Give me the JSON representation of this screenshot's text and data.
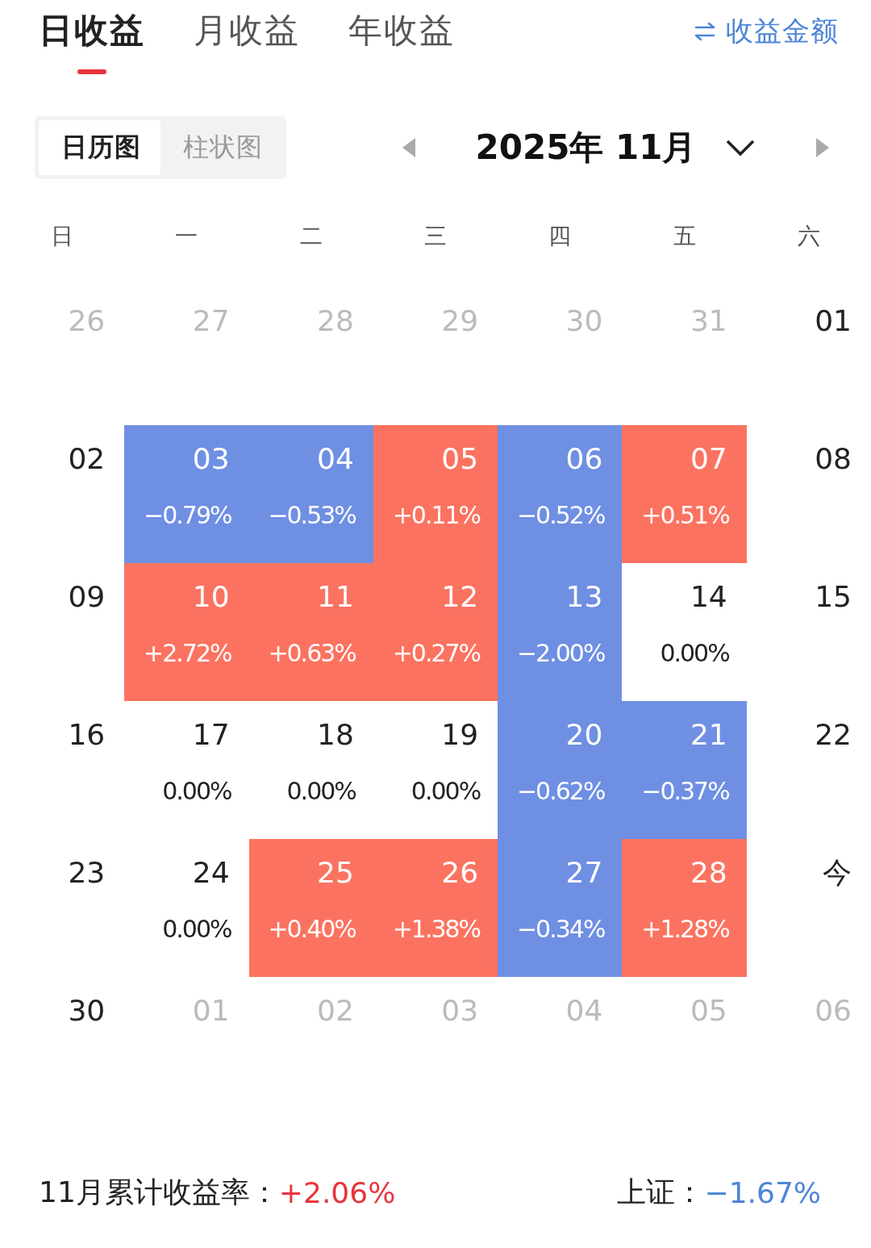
{
  "tabs": [
    {
      "label": "日收益",
      "selected": true
    },
    {
      "label": "月收益",
      "selected": false
    },
    {
      "label": "年收益",
      "selected": false
    }
  ],
  "switch_link": {
    "label": "收益金额"
  },
  "view_toggle": [
    {
      "label": "日历图",
      "selected": true
    },
    {
      "label": "柱状图",
      "selected": false
    }
  ],
  "month_picker": {
    "label": "2025年 11月"
  },
  "weekdays": [
    "日",
    "一",
    "二",
    "三",
    "四",
    "五",
    "六"
  ],
  "weeks": [
    {
      "days": [
        {
          "day": "26",
          "muted": true
        },
        {
          "day": "27",
          "muted": true
        },
        {
          "day": "28",
          "muted": true
        },
        {
          "day": "29",
          "muted": true
        },
        {
          "day": "30",
          "muted": true
        },
        {
          "day": "31",
          "muted": true
        },
        {
          "day": "01",
          "muted": false
        }
      ]
    },
    {
      "days": [
        {
          "day": "02",
          "muted": false
        },
        {
          "day": "03",
          "value": "−0.79%",
          "color": "#6f8fe3"
        },
        {
          "day": "04",
          "value": "−0.53%",
          "color": "#6f8fe3"
        },
        {
          "day": "05",
          "value": "+0.11%",
          "color": "#fb7360"
        },
        {
          "day": "06",
          "value": "−0.52%",
          "color": "#6f8fe3"
        },
        {
          "day": "07",
          "value": "+0.51%",
          "color": "#fb7360"
        },
        {
          "day": "08",
          "muted": false
        }
      ]
    },
    {
      "days": [
        {
          "day": "09",
          "muted": false
        },
        {
          "day": "10",
          "value": "+2.72%",
          "color": "#fb7360"
        },
        {
          "day": "11",
          "value": "+0.63%",
          "color": "#fb7360"
        },
        {
          "day": "12",
          "value": "+0.27%",
          "color": "#fb7360"
        },
        {
          "day": "13",
          "value": "−2.00%",
          "color": "#6f8fe3"
        },
        {
          "day": "14",
          "muted": false,
          "value": "0.00%"
        },
        {
          "day": "15",
          "muted": false
        }
      ]
    },
    {
      "days": [
        {
          "day": "16",
          "muted": false
        },
        {
          "day": "17",
          "muted": false,
          "value": "0.00%"
        },
        {
          "day": "18",
          "muted": false,
          "value": "0.00%"
        },
        {
          "day": "19",
          "muted": false,
          "value": "0.00%"
        },
        {
          "day": "20",
          "value": "−0.62%",
          "color": "#6f8fe3"
        },
        {
          "day": "21",
          "value": "−0.37%",
          "color": "#6f8fe3"
        },
        {
          "day": "22",
          "muted": false
        }
      ]
    },
    {
      "days": [
        {
          "day": "23",
          "muted": false
        },
        {
          "day": "24",
          "muted": false,
          "value": "0.00%"
        },
        {
          "day": "25",
          "value": "+0.40%",
          "color": "#fb7360"
        },
        {
          "day": "26",
          "value": "+1.38%",
          "color": "#fb7360"
        },
        {
          "day": "27",
          "value": "−0.34%",
          "color": "#6f8fe3"
        },
        {
          "day": "28",
          "value": "+1.28%",
          "color": "#fb7360"
        },
        {
          "day": "今",
          "muted": false
        }
      ]
    },
    {
      "days": [
        {
          "day": "30",
          "muted": false
        },
        {
          "day": "01",
          "muted": true
        },
        {
          "day": "02",
          "muted": true
        },
        {
          "day": "03",
          "muted": true
        },
        {
          "day": "04",
          "muted": true
        },
        {
          "day": "05",
          "muted": true
        },
        {
          "day": "06",
          "muted": true
        }
      ]
    }
  ],
  "summary": {
    "label": "11月累计收益率：",
    "value": "+2.06%",
    "benchmark_label": "上证：",
    "benchmark_value": "−1.67%"
  }
}
